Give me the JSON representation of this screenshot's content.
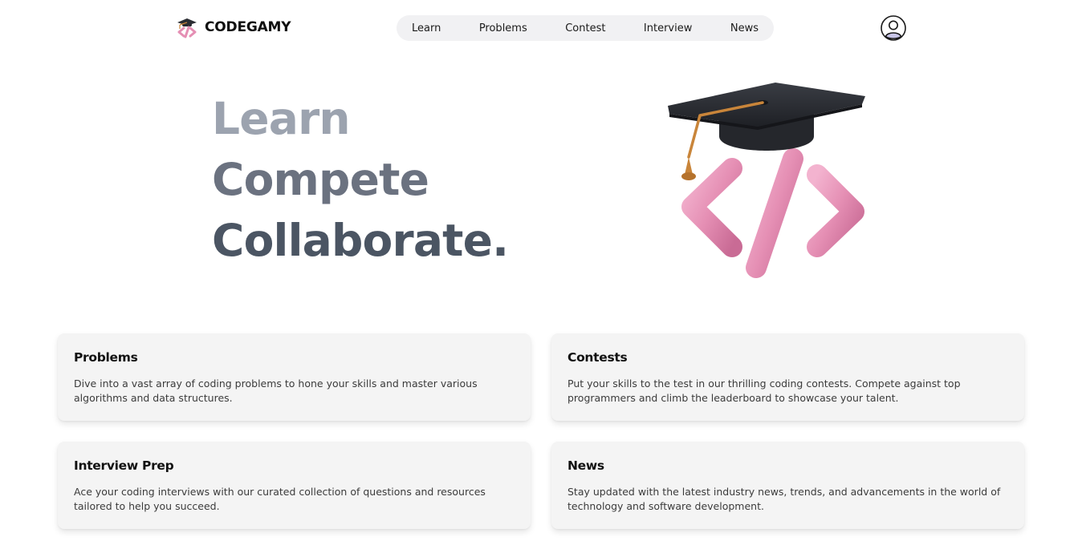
{
  "brand": {
    "name": "CODEGAMY",
    "logo_icon": "graduation-cap-code-icon"
  },
  "nav": {
    "items": [
      {
        "label": "Learn"
      },
      {
        "label": "Problems"
      },
      {
        "label": "Contest"
      },
      {
        "label": "Interview"
      },
      {
        "label": "News"
      }
    ]
  },
  "user": {
    "avatar_icon": "user-avatar-icon"
  },
  "hero": {
    "line1": "Learn",
    "line2": "Compete",
    "line3": "Collaborate.",
    "illustration": "graduation-cap-code-illustration",
    "colors": {
      "line1": "#9ca3af",
      "line2": "#6b7280",
      "line3": "#4b5563",
      "cap": "#2b2d33",
      "tassel": "#c9853a",
      "code_symbol": "#e58fb4"
    }
  },
  "cards": [
    {
      "title": "Problems",
      "description": "Dive into a vast array of coding problems to hone your skills and master various algorithms and data structures."
    },
    {
      "title": "Contests",
      "description": "Put your skills to the test in our thrilling coding contests. Compete against top programmers and climb the leaderboard to showcase your talent."
    },
    {
      "title": "Interview Prep",
      "description": "Ace your coding interviews with our curated collection of questions and resources tailored to help you succeed."
    },
    {
      "title": "News",
      "description": "Stay updated with the latest industry news, trends, and advancements in the world of technology and software development."
    }
  ]
}
